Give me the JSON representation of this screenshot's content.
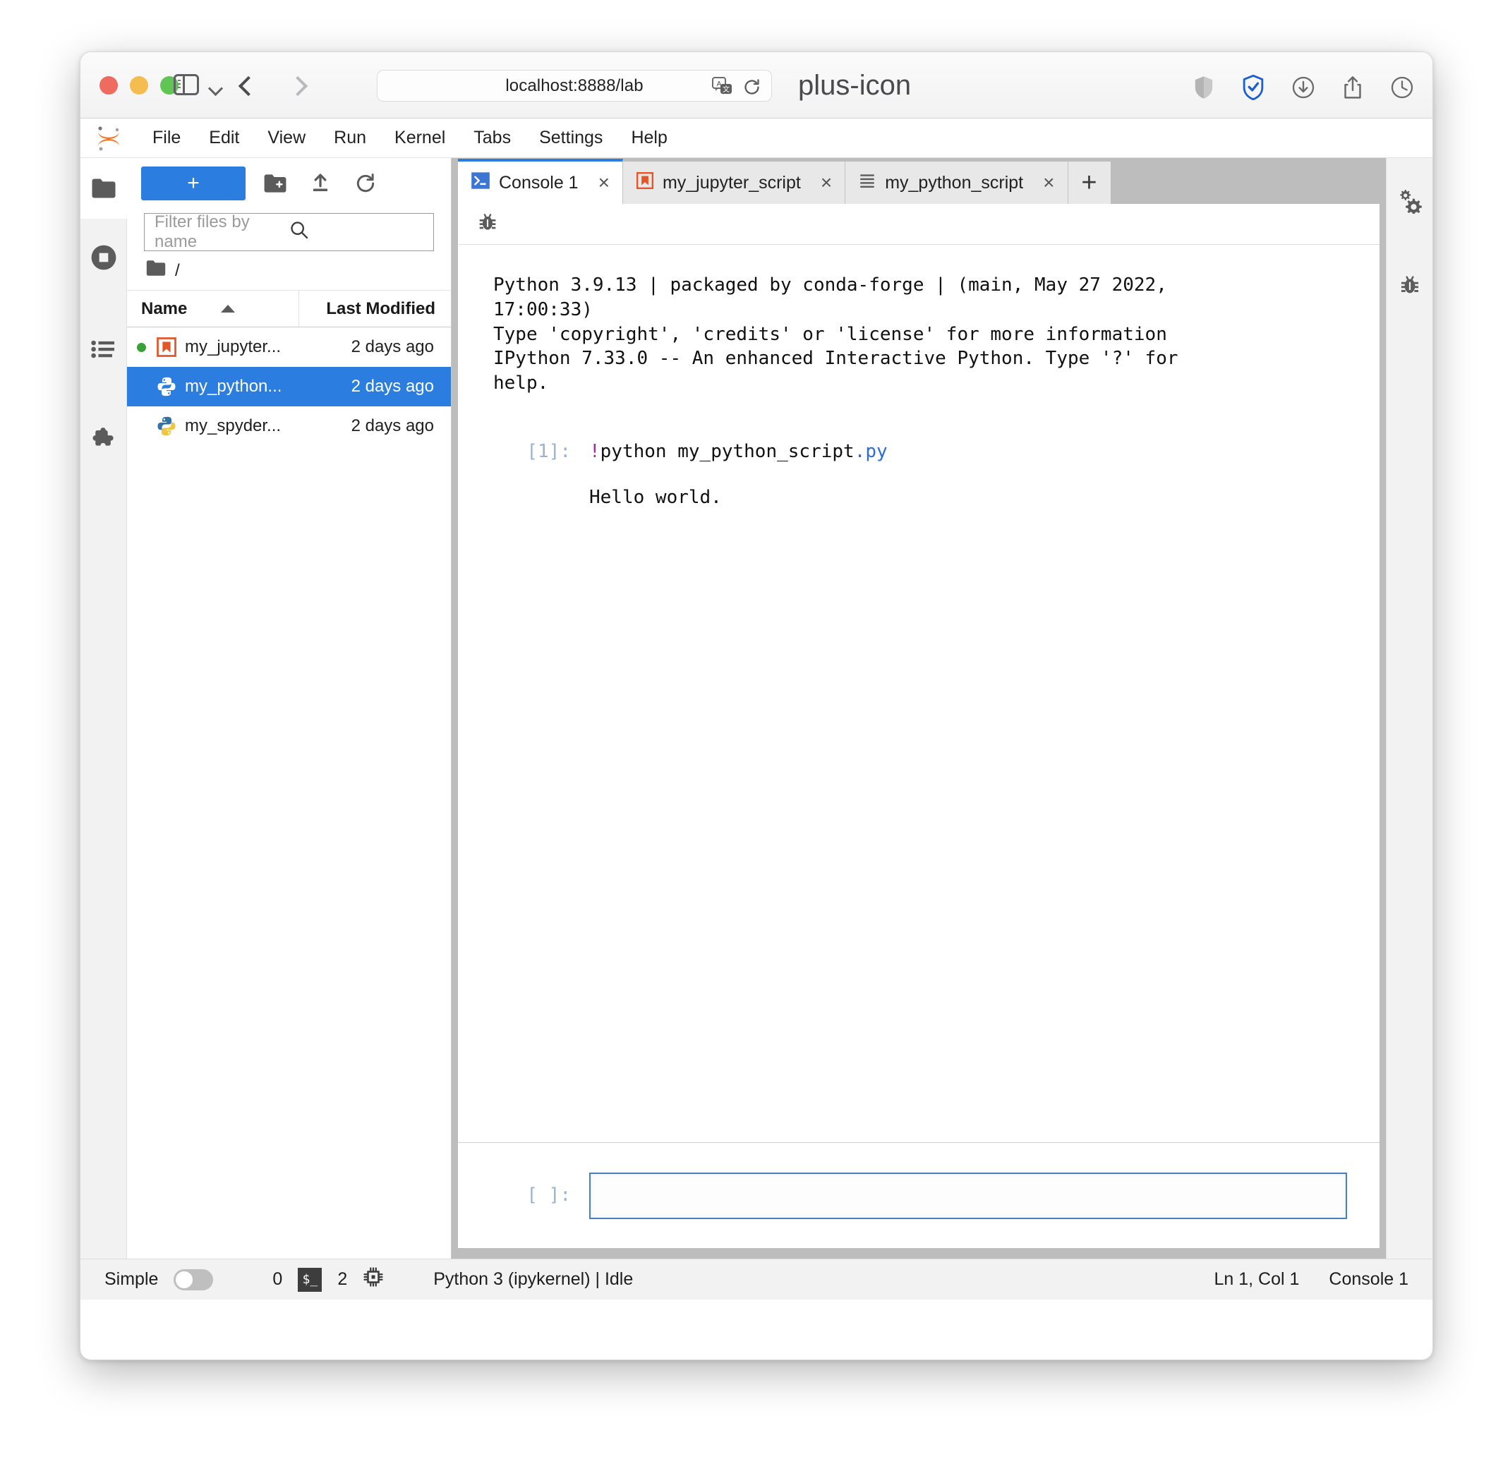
{
  "browser": {
    "url": "localhost:8888/lab",
    "traffic_lights": [
      "close-red",
      "minimize-yellow",
      "zoom-green"
    ],
    "icons": {
      "sidebar_toggle": "sidebar-toggle-icon",
      "tab_overview": "chevron-down-icon",
      "back": "back-arrow-icon",
      "forward": "forward-arrow-icon",
      "translate": "translate-icon",
      "reload": "reload-icon",
      "new_tab": "plus-icon",
      "privacy_report": "shield-icon",
      "extension_shield": "blue-shield-check-icon",
      "downloads": "download-icon",
      "share": "share-icon",
      "history": "history-clock-icon"
    }
  },
  "menubar": {
    "logo": "jupyter-logo",
    "items": [
      "File",
      "Edit",
      "View",
      "Run",
      "Kernel",
      "Tabs",
      "Settings",
      "Help"
    ]
  },
  "left_rail": {
    "items": [
      {
        "name": "file-browser",
        "icon": "folder-icon",
        "active": true
      },
      {
        "name": "running-terminals-kernels",
        "icon": "stop-circle-icon",
        "active": false
      },
      {
        "name": "table-of-contents",
        "icon": "list-icon",
        "active": false
      },
      {
        "name": "extension-manager",
        "icon": "puzzle-icon",
        "active": false
      }
    ]
  },
  "right_rail": {
    "items": [
      {
        "name": "property-inspector",
        "icon": "gears-icon"
      },
      {
        "name": "debugger",
        "icon": "bug-icon"
      }
    ]
  },
  "filebrowser": {
    "new_launcher_label": "+",
    "toolbar_icons": [
      "new-folder-icon",
      "upload-icon",
      "refresh-icon"
    ],
    "filter_placeholder": "Filter files by name",
    "search_icon": "search-icon",
    "breadcrumb": "/",
    "columns": {
      "name": "Name",
      "last_modified": "Last Modified"
    },
    "sort_indicator": "ascending-caret",
    "files": [
      {
        "name": "my_jupyter...",
        "modified": "2 days ago",
        "icon": "notebook-icon",
        "running": true,
        "selected": false
      },
      {
        "name": "my_python...",
        "modified": "2 days ago",
        "icon": "python-file-icon",
        "running": false,
        "selected": true
      },
      {
        "name": "my_spyder...",
        "modified": "2 days ago",
        "icon": "python-file-icon",
        "running": false,
        "selected": false
      }
    ]
  },
  "dock": {
    "tabs": [
      {
        "label": "Console 1",
        "icon": "console-icon",
        "active": true,
        "close": "×"
      },
      {
        "label": "my_jupyter_script",
        "icon": "notebook-icon",
        "active": false,
        "close": "×"
      },
      {
        "label": "my_python_script",
        "icon": "text-file-icon",
        "active": false,
        "close": "×"
      }
    ],
    "add_tab_label": "+",
    "toolbar_icons": [
      "bug-icon"
    ]
  },
  "console": {
    "banner": "Python 3.9.13 | packaged by conda-forge | (main, May 27 2022, 17:00:33)\nType 'copyright', 'credits' or 'license' for more information\nIPython 7.33.0 -- An enhanced Interactive Python. Type '?' for help.",
    "cells": [
      {
        "prompt": "[1]:",
        "code_bang": "!",
        "code_main": "python my_python_script",
        "code_ext": ".py",
        "output": "Hello world."
      }
    ],
    "input_prompt": "[ ]:",
    "input_value": ""
  },
  "statusbar": {
    "simple_label": "Simple",
    "simple_toggle_on": false,
    "terminals_count": "0",
    "terminal_icon": "terminal-icon",
    "kernels_count": "2",
    "kernel_icon": "kernel-chip-icon",
    "kernel_status": "Python 3 (ipykernel) | Idle",
    "cursor_position": "Ln 1, Col 1",
    "active_document": "Console 1"
  },
  "colors": {
    "accent_blue": "#2b7de0",
    "jupyter_orange": "#f37726",
    "selection_blue": "#2b7de0",
    "prompt_blue": "#99b4d1",
    "magenta": "#a626a4"
  }
}
